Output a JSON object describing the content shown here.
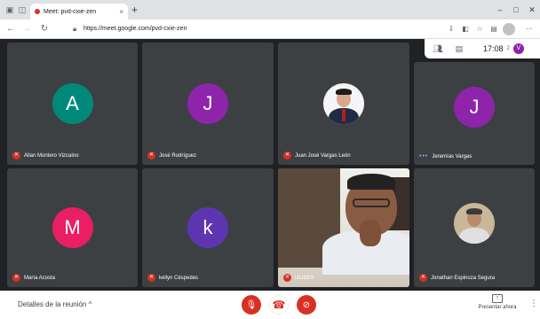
{
  "browser": {
    "tab_title": "Meet: pvd-cxie-zen",
    "tab_close": "×",
    "new_tab": "+",
    "url": "https://meet.google.com/pvd-cxie-zen",
    "minimize": "–",
    "restore": "□",
    "close": "✕"
  },
  "toppanel": {
    "time": "17:08",
    "sub": "2",
    "me_initial": "V"
  },
  "colors": {
    "accent_red": "#d93025",
    "tile": "#3c4043"
  },
  "participants": [
    {
      "name": "Allan Montero Vizcaíno",
      "initial": "A",
      "color": "#00897b",
      "muted": true
    },
    {
      "name": "José Rodríguez",
      "initial": "J",
      "color": "#8e24aa",
      "muted": true
    },
    {
      "name": "Juan José Vargas León",
      "initial": "",
      "muted": true
    },
    {
      "name": "Jeremías Vargas",
      "initial": "J",
      "color": "#8e24aa",
      "muted": false
    },
    {
      "name": "María Acosta",
      "initial": "M",
      "color": "#e91e63",
      "muted": true
    },
    {
      "name": "kellyn Céspedes",
      "initial": "k",
      "color": "#5e35b1",
      "muted": true
    },
    {
      "name": "ULISES",
      "initial": "",
      "muted": true
    },
    {
      "name": "Jonathan Espinoza Segura",
      "initial": "",
      "muted": true
    }
  ],
  "bottombar": {
    "details": "Detalles de la reunión",
    "details_chevron": "^",
    "present": "Presentar ahora",
    "more": "⋮"
  }
}
